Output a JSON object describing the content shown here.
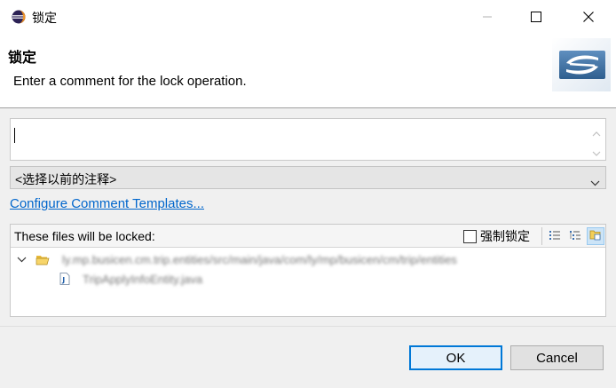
{
  "window": {
    "title": "锁定",
    "icon": "eclipse-icon",
    "controls": [
      "minimize-icon",
      "maximize-icon",
      "close-icon"
    ]
  },
  "header": {
    "title": "锁定",
    "message": "Enter a comment for the lock operation.",
    "image": "svn-banner-icon"
  },
  "comment": {
    "value": ""
  },
  "history": {
    "selected": "<选择以前的注释>"
  },
  "configure_link": "Configure Comment Templates...",
  "files": {
    "label": "These files will be locked:",
    "force_lock_label": "强制锁定",
    "force_lock_checked": false,
    "toolbar_icons": [
      "flat-list-icon",
      "tree-view-icon",
      "compressed-folders-icon"
    ],
    "tree": [
      {
        "type": "folder",
        "expanded": true,
        "label": "ly.mp.busicen.cm.trip.entities/src/main/java/com/ly/mp/busicen/cm/trip/entities"
      },
      {
        "type": "java-file",
        "label": "TripApplyInfoEntity.java"
      }
    ]
  },
  "buttons": {
    "ok": "OK",
    "cancel": "Cancel"
  },
  "colors": {
    "link": "#0066cc",
    "default_button_border": "#0078d7",
    "panel_background": "#f0f0f0"
  }
}
